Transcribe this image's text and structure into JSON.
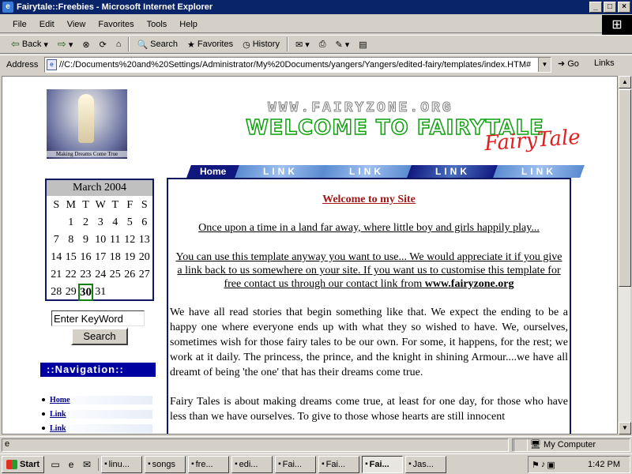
{
  "window": {
    "title": "Fairytale::Freebies - Microsoft Internet Explorer",
    "buttons": [
      "_",
      "□",
      "×"
    ]
  },
  "menu": [
    "File",
    "Edit",
    "View",
    "Favorites",
    "Tools",
    "Help"
  ],
  "toolbar": {
    "back": "Back",
    "search": "Search",
    "favorites": "Favorites",
    "history": "History"
  },
  "address": {
    "label": "Address",
    "url": "//C:/Documents%20and%20Settings/Administrator/My%20Documents/yangers/Yangers/edited-fairy/templates/index.HTM#",
    "go": "Go",
    "links": "Links"
  },
  "page": {
    "logo_caption": "Making Dreams Come True",
    "site_url": "WWW.FAIRYZONE.ORG",
    "welcome_banner": "WELCOME TO FAIRYTALE",
    "script_logo": "FairyTale",
    "tabs": [
      {
        "label": "Home"
      },
      {
        "label": "LINK"
      },
      {
        "label": "LINK"
      },
      {
        "label": "LINK"
      },
      {
        "label": "LINK"
      }
    ],
    "calendar": {
      "title": "March 2004",
      "weekdays": [
        "S",
        "M",
        "T",
        "",
        "W",
        "T",
        "F",
        "S"
      ],
      "rows": [
        [
          "S",
          "M",
          "T",
          "W",
          "T",
          "F",
          "S"
        ],
        [
          "",
          "1",
          "2",
          "3",
          "4",
          "5",
          "6"
        ],
        [
          "7",
          "8",
          "9",
          "10",
          "11",
          "12",
          "13"
        ],
        [
          "14",
          "15",
          "16",
          "17",
          "18",
          "19",
          "20"
        ],
        [
          "21",
          "22",
          "23",
          "24",
          "25",
          "26",
          "27"
        ],
        [
          "28",
          "29",
          "30",
          "31",
          "",
          "",
          ""
        ]
      ],
      "today": "30"
    },
    "search_placeholder": "Enter KeyWord",
    "search_button": "Search",
    "nav_header": "::Navigation::",
    "nav_items": [
      "Home",
      "Link",
      "Link"
    ],
    "content": {
      "welcome": "Welcome to my Site",
      "once": "Once upon a time in a land far away, where little boy and girls happily play...",
      "use_text": "You can use this template anyway you want to use... We would appreciate it if you give a link back to us somewhere on your site. If you want us to customise this template for free contact us through our contact link from",
      "use_link": "www.fairyzone.org",
      "para1": "We have all read stories that begin something like that. We expect the ending to be a happy one where everyone ends up with what they so wished to have. We, ourselves, sometimes wish for those fairy tales to be our own. For some, it happens, for the rest; we work at it daily. The princess, the prince, and the knight in shining Armour....we have all dreamt of being 'the one' that has their dreams come true.",
      "para2": "Fairy Tales is about making dreams come true, at least for one day, for those who have less than we have ourselves. To give to those whose hearts are still innocent"
    }
  },
  "status": {
    "zone": "My Computer"
  },
  "taskbar": {
    "start": "Start",
    "tasks": [
      {
        "label": "linu...",
        "active": false
      },
      {
        "label": "songs",
        "active": false
      },
      {
        "label": "fre...",
        "active": false
      },
      {
        "label": "edi...",
        "active": false
      },
      {
        "label": "Fai...",
        "active": false
      },
      {
        "label": "Fai...",
        "active": false
      },
      {
        "label": "Fai...",
        "active": true
      },
      {
        "label": "Jas...",
        "active": false
      }
    ],
    "clock": "1:42 PM"
  }
}
